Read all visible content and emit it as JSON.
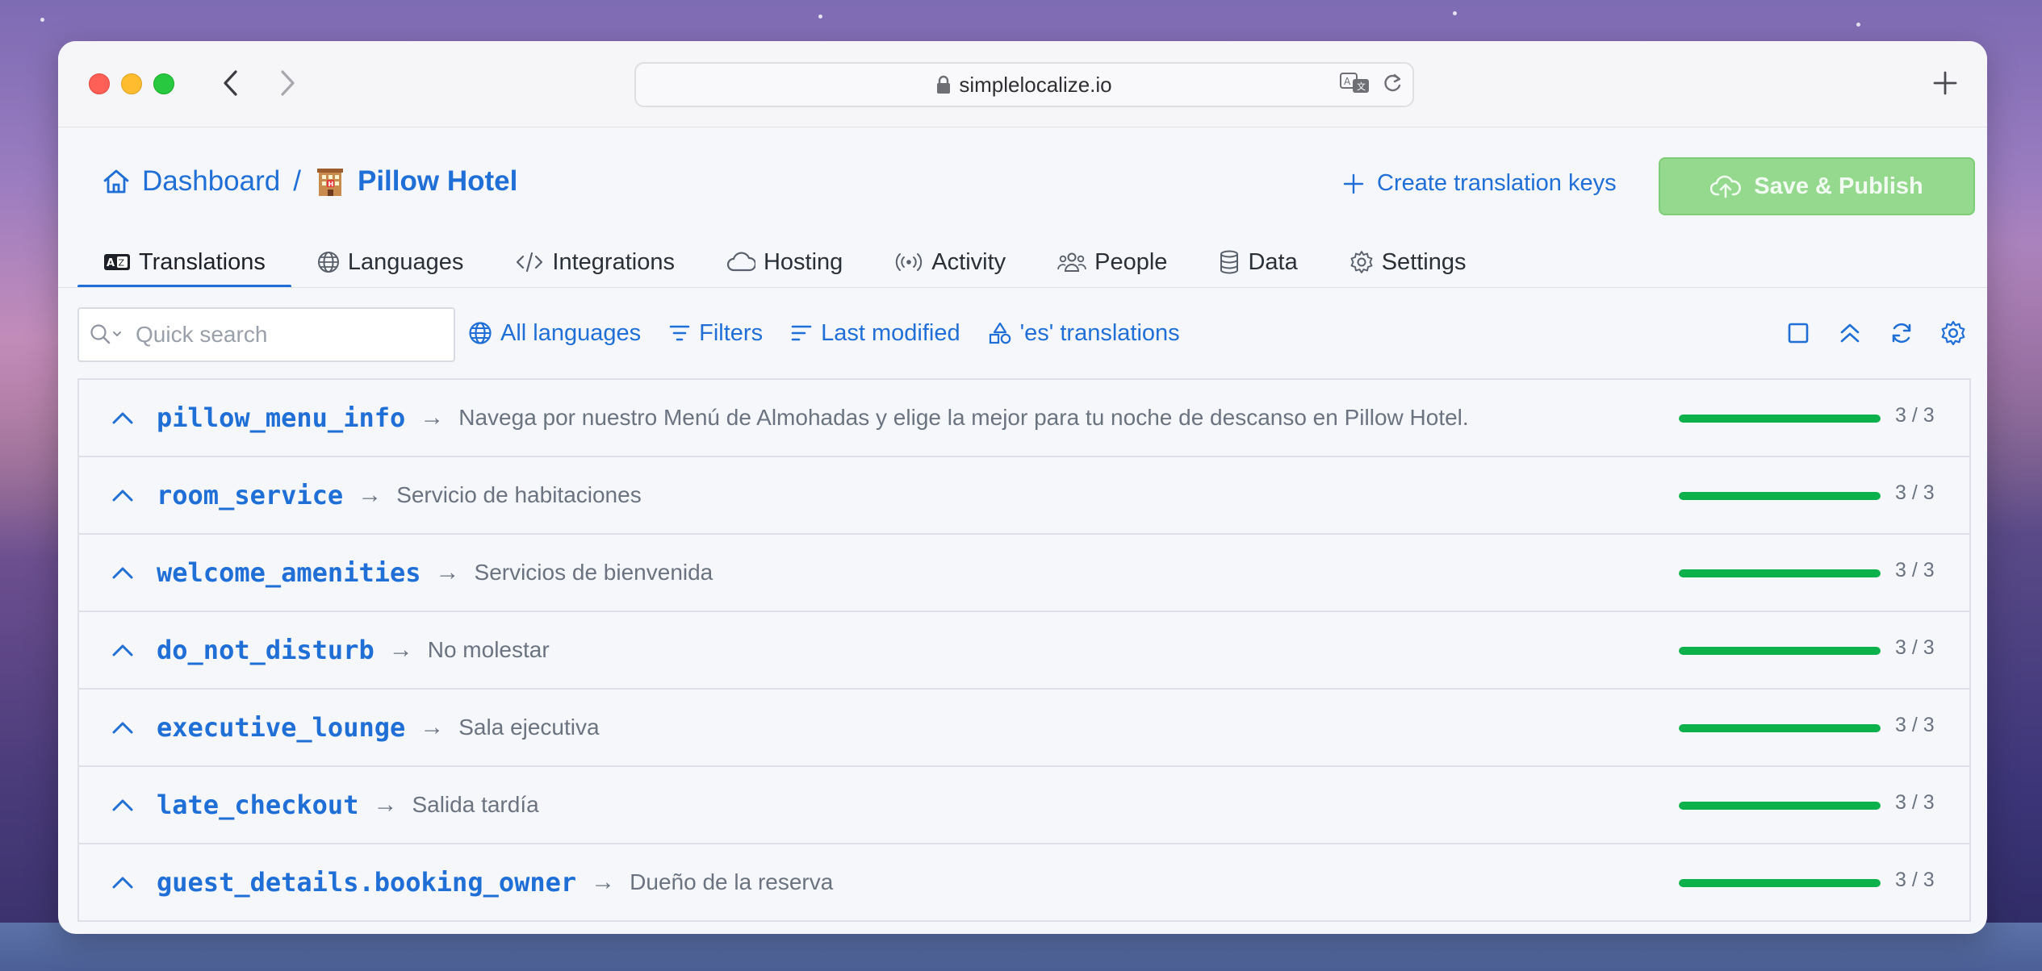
{
  "browser": {
    "url": "simplelocalize.io"
  },
  "breadcrumb": {
    "dashboard": "Dashboard",
    "separator": "/",
    "project": "Pillow Hotel"
  },
  "actions": {
    "create_keys": "Create translation keys",
    "publish": "Save & Publish"
  },
  "tabs": [
    {
      "label": "Translations",
      "icon": "translate-icon",
      "active": true
    },
    {
      "label": "Languages",
      "icon": "globe-icon"
    },
    {
      "label": "Integrations",
      "icon": "code-icon"
    },
    {
      "label": "Hosting",
      "icon": "cloud-icon"
    },
    {
      "label": "Activity",
      "icon": "broadcast-icon"
    },
    {
      "label": "People",
      "icon": "people-icon"
    },
    {
      "label": "Data",
      "icon": "database-icon"
    },
    {
      "label": "Settings",
      "icon": "gear-icon"
    }
  ],
  "toolbar": {
    "search_placeholder": "Quick search",
    "all_languages": "All languages",
    "filters": "Filters",
    "sort": "Last modified",
    "view": "'es' translations"
  },
  "colors": {
    "accent": "#1f6fd6",
    "progress": "#0db14b",
    "publish_bg": "#95d98f"
  },
  "rows": [
    {
      "key": "pillow_menu_info",
      "value": "Navega por nuestro Menú de Almohadas y elige la mejor para tu noche de descanso en Pillow Hotel.",
      "count": "3 / 3",
      "progress": 1.0
    },
    {
      "key": "room_service",
      "value": "Servicio de habitaciones",
      "count": "3 / 3",
      "progress": 1.0
    },
    {
      "key": "welcome_amenities",
      "value": "Servicios de bienvenida",
      "count": "3 / 3",
      "progress": 1.0
    },
    {
      "key": "do_not_disturb",
      "value": "No molestar",
      "count": "3 / 3",
      "progress": 1.0
    },
    {
      "key": "executive_lounge",
      "value": "Sala ejecutiva",
      "count": "3 / 3",
      "progress": 1.0
    },
    {
      "key": "late_checkout",
      "value": "Salida tardía",
      "count": "3 / 3",
      "progress": 1.0
    },
    {
      "key": "guest_details.booking_owner",
      "value": "Dueño de la reserva",
      "count": "3 / 3",
      "progress": 1.0
    }
  ]
}
